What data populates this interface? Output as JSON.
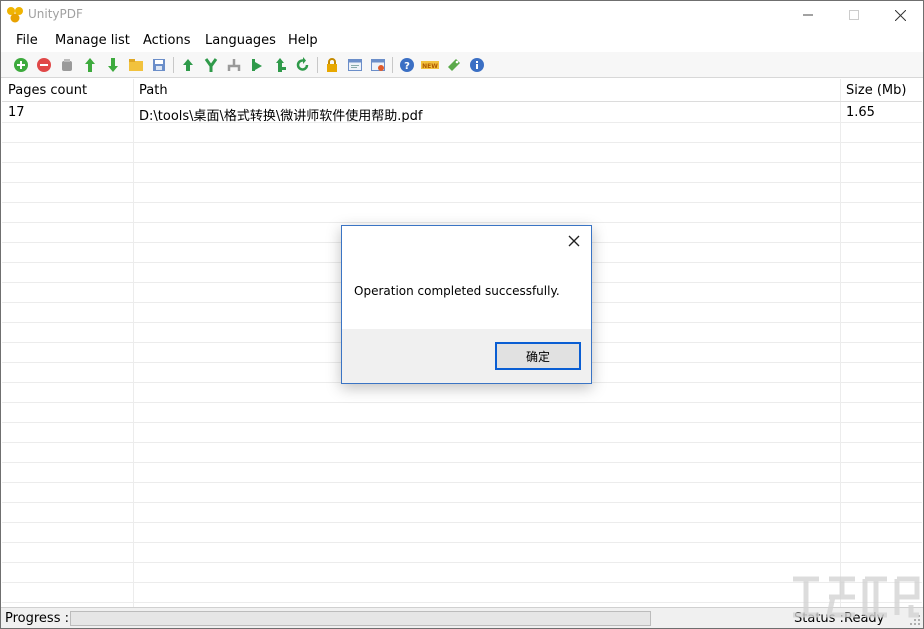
{
  "window": {
    "title": "UnityPDF"
  },
  "menu": {
    "items": [
      "File",
      "Manage list",
      "Actions",
      "Languages",
      "Help"
    ]
  },
  "toolbar": {
    "buttons": [
      "add-icon",
      "remove-icon",
      "clear-icon",
      "move-up-icon",
      "move-down-icon",
      "open-folder-icon",
      "save-list-icon",
      "merge-icon",
      "split-icon",
      "extract-icon",
      "insert-icon",
      "append-icon",
      "rotate-icon",
      "lock-icon",
      "properties-icon",
      "options-icon",
      "help-icon",
      "new-icon",
      "register-icon",
      "info-icon"
    ]
  },
  "table": {
    "columns": [
      "Pages count",
      "Path",
      "Size (Mb)"
    ],
    "rows": [
      {
        "pages": "17",
        "path": "D:\\tools\\桌面\\格式转换\\微讲师软件使用帮助.pdf",
        "size": "1.65"
      }
    ]
  },
  "statusbar": {
    "progress_label": "Progress :",
    "progress_value": 0,
    "status_label": "Status :",
    "status_value": "Ready"
  },
  "dialog": {
    "message": "Operation completed successfully.",
    "ok_label": "确定"
  },
  "colors": {
    "accent": "#0a5ed3",
    "dialog_border": "#3a74c4"
  }
}
